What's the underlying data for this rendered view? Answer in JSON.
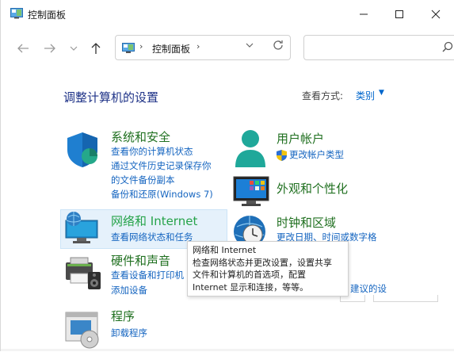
{
  "window": {
    "title": "控制面板",
    "minimize_glyph": "—",
    "maximize_glyph": "☐",
    "close_glyph": "✕"
  },
  "address": {
    "breadcrumb": "控制面板",
    "search_placeholder": ""
  },
  "main": {
    "heading": "调整计算机的设置",
    "view_by_label": "查看方式:",
    "view_by_value": "类别"
  },
  "categories": {
    "system_security": {
      "title": "系统和安全",
      "links": [
        "查看你的计算机状态",
        "通过文件历史记录保存你",
        "的文件备份副本",
        "备份和还原(Windows 7)"
      ]
    },
    "network": {
      "title": "网络和 Internet",
      "links": [
        "查看网络状态和任务"
      ]
    },
    "hardware_sound": {
      "title": "硬件和声音",
      "links": [
        "查看设备和打印机",
        "添加设备"
      ]
    },
    "programs": {
      "title": "程序",
      "links": [
        "卸载程序"
      ]
    },
    "user_accounts": {
      "title": "用户帐户",
      "links": [
        "更改帐户类型"
      ]
    },
    "appearance": {
      "title": "外观和个性化"
    },
    "clock_region": {
      "title": "时钟和区域",
      "links_partial": [
        "更改日期、时间或数字格"
      ],
      "link_fragment": "建议的设"
    }
  },
  "tooltip": {
    "lines": [
      "网络和 Internet",
      "检查网络状态并更改设置，设置共享",
      "文件和计算机的首选项，配置",
      "Internet 显示和连接，等等。"
    ]
  },
  "colors": {
    "title_green": "#207020",
    "link_blue": "#1565c0",
    "heading_blue": "#1e3287",
    "hover_bg": "#e5f1fb"
  }
}
